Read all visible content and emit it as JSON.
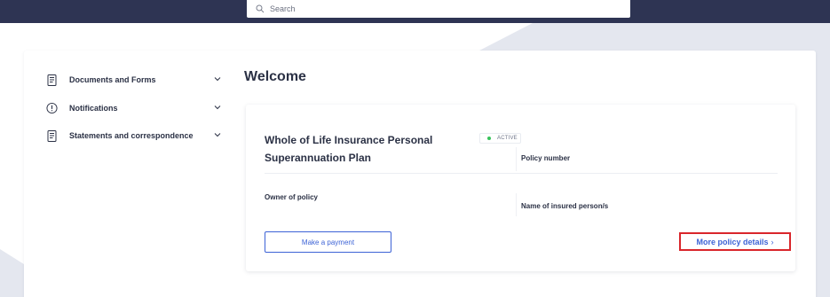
{
  "header": {
    "search": {
      "placeholder": "Search",
      "value": ""
    }
  },
  "sidebar": {
    "items": [
      {
        "label": "Documents and Forms",
        "icon": "document-icon"
      },
      {
        "label": "Notifications",
        "icon": "alert-circle-icon"
      },
      {
        "label": "Statements and correspondence",
        "icon": "document-icon"
      }
    ]
  },
  "main": {
    "title": "Welcome",
    "policy": {
      "name": "Whole of Life Insurance Personal Superannuation Plan",
      "status": "ACTIVE",
      "policy_number_label": "Policy number",
      "owner_label": "Owner of policy",
      "insured_label": "Name of insured person/s",
      "make_payment_label": "Make a payment",
      "more_details_label": "More policy details"
    }
  },
  "colors": {
    "header_bg": "#2e3453",
    "accent_blue": "#3d63d6",
    "status_green": "#37c25a",
    "highlight_red": "#d9262b",
    "page_bg": "#e4e7ef"
  }
}
